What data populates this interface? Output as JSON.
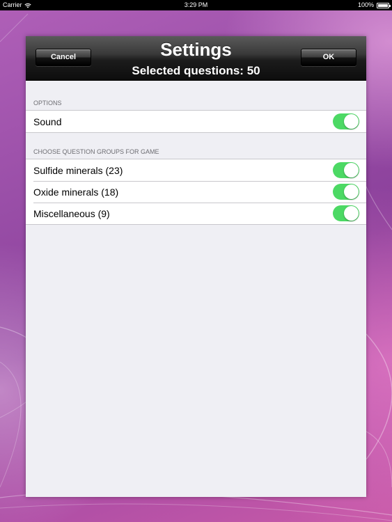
{
  "status_bar": {
    "carrier": "Carrier",
    "time": "3:29 PM",
    "battery": "100%",
    "battery_level": 1.0
  },
  "header": {
    "title": "Settings",
    "subtitle": "Selected questions: 50",
    "cancel_label": "Cancel",
    "ok_label": "OK"
  },
  "options_section": {
    "title": "OPTIONS",
    "items": [
      {
        "label": "Sound",
        "on": true
      }
    ]
  },
  "groups_section": {
    "title": "CHOOSE QUESTION GROUPS FOR GAME",
    "items": [
      {
        "label": "Sulfide minerals (23)",
        "on": true
      },
      {
        "label": "Oxide minerals (18)",
        "on": true
      },
      {
        "label": "Miscellaneous (9)",
        "on": true
      }
    ]
  },
  "colors": {
    "toggle_on": "#4cd964",
    "header_bg": "#1c1c1c",
    "list_bg": "#efeff4"
  }
}
